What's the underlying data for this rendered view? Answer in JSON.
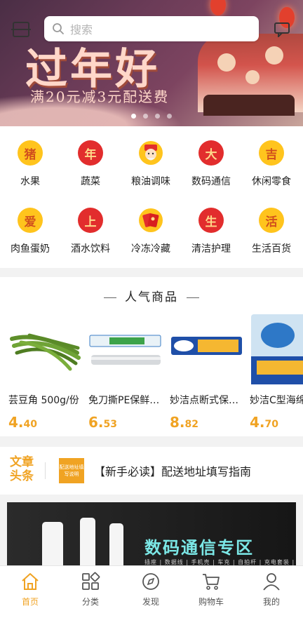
{
  "search": {
    "placeholder": "搜索"
  },
  "banner": {
    "title": "过年好",
    "subtitle": "满20元减3元配送费",
    "slides": 4,
    "active": 0
  },
  "categories": [
    {
      "label": "水果",
      "glyph": "猪",
      "icon": "pig-icon",
      "style": "y"
    },
    {
      "label": "蔬菜",
      "glyph": "年",
      "icon": "year-icon",
      "style": "r"
    },
    {
      "label": "粮油调味",
      "glyph": "",
      "icon": "god-of-wealth-icon",
      "style": "p"
    },
    {
      "label": "数码通信",
      "glyph": "大",
      "icon": "big-icon",
      "style": "r"
    },
    {
      "label": "休闲零食",
      "glyph": "吉",
      "icon": "luck-icon",
      "style": "y"
    },
    {
      "label": "肉鱼蛋奶",
      "glyph": "爱",
      "icon": "love-icon",
      "style": "y"
    },
    {
      "label": "酒水饮料",
      "glyph": "上",
      "icon": "up-icon",
      "style": "r"
    },
    {
      "label": "冷冻冷藏",
      "glyph": "",
      "icon": "red-packet-icon",
      "style": "p"
    },
    {
      "label": "清洁护理",
      "glyph": "生",
      "icon": "life-icon",
      "style": "r"
    },
    {
      "label": "生活百货",
      "glyph": "活",
      "icon": "live-icon",
      "style": "y"
    }
  ],
  "hot": {
    "title": "人气商品",
    "items": [
      {
        "name": "芸豆角 500g/份",
        "price_int": "4.",
        "price_dec": "40"
      },
      {
        "name": "免刀撕PE保鲜…",
        "price_int": "6.",
        "price_dec": "53"
      },
      {
        "name": "妙洁点断式保…",
        "price_int": "8.",
        "price_dec": "82"
      },
      {
        "name": "妙洁C型海绵",
        "price_int": "4.",
        "price_dec": "70"
      }
    ]
  },
  "notice": {
    "tag": "文章头条",
    "thumb": "配送地址填写说明",
    "text": "【新手必读】配送地址填写指南"
  },
  "digital": {
    "title": "数码通信专区",
    "subtitle": "插座 | 数据线 | 手机壳 | 车充 | 自拍杆 | 充电套装 | 钢化膜"
  },
  "tabs": [
    {
      "label": "首页",
      "active": true
    },
    {
      "label": "分类",
      "active": false
    },
    {
      "label": "发现",
      "active": false
    },
    {
      "label": "购物车",
      "active": false
    },
    {
      "label": "我的",
      "active": false
    }
  ],
  "colors": {
    "accent": "#f0a323",
    "red": "#e22d2d",
    "yellow": "#ffc41d"
  }
}
